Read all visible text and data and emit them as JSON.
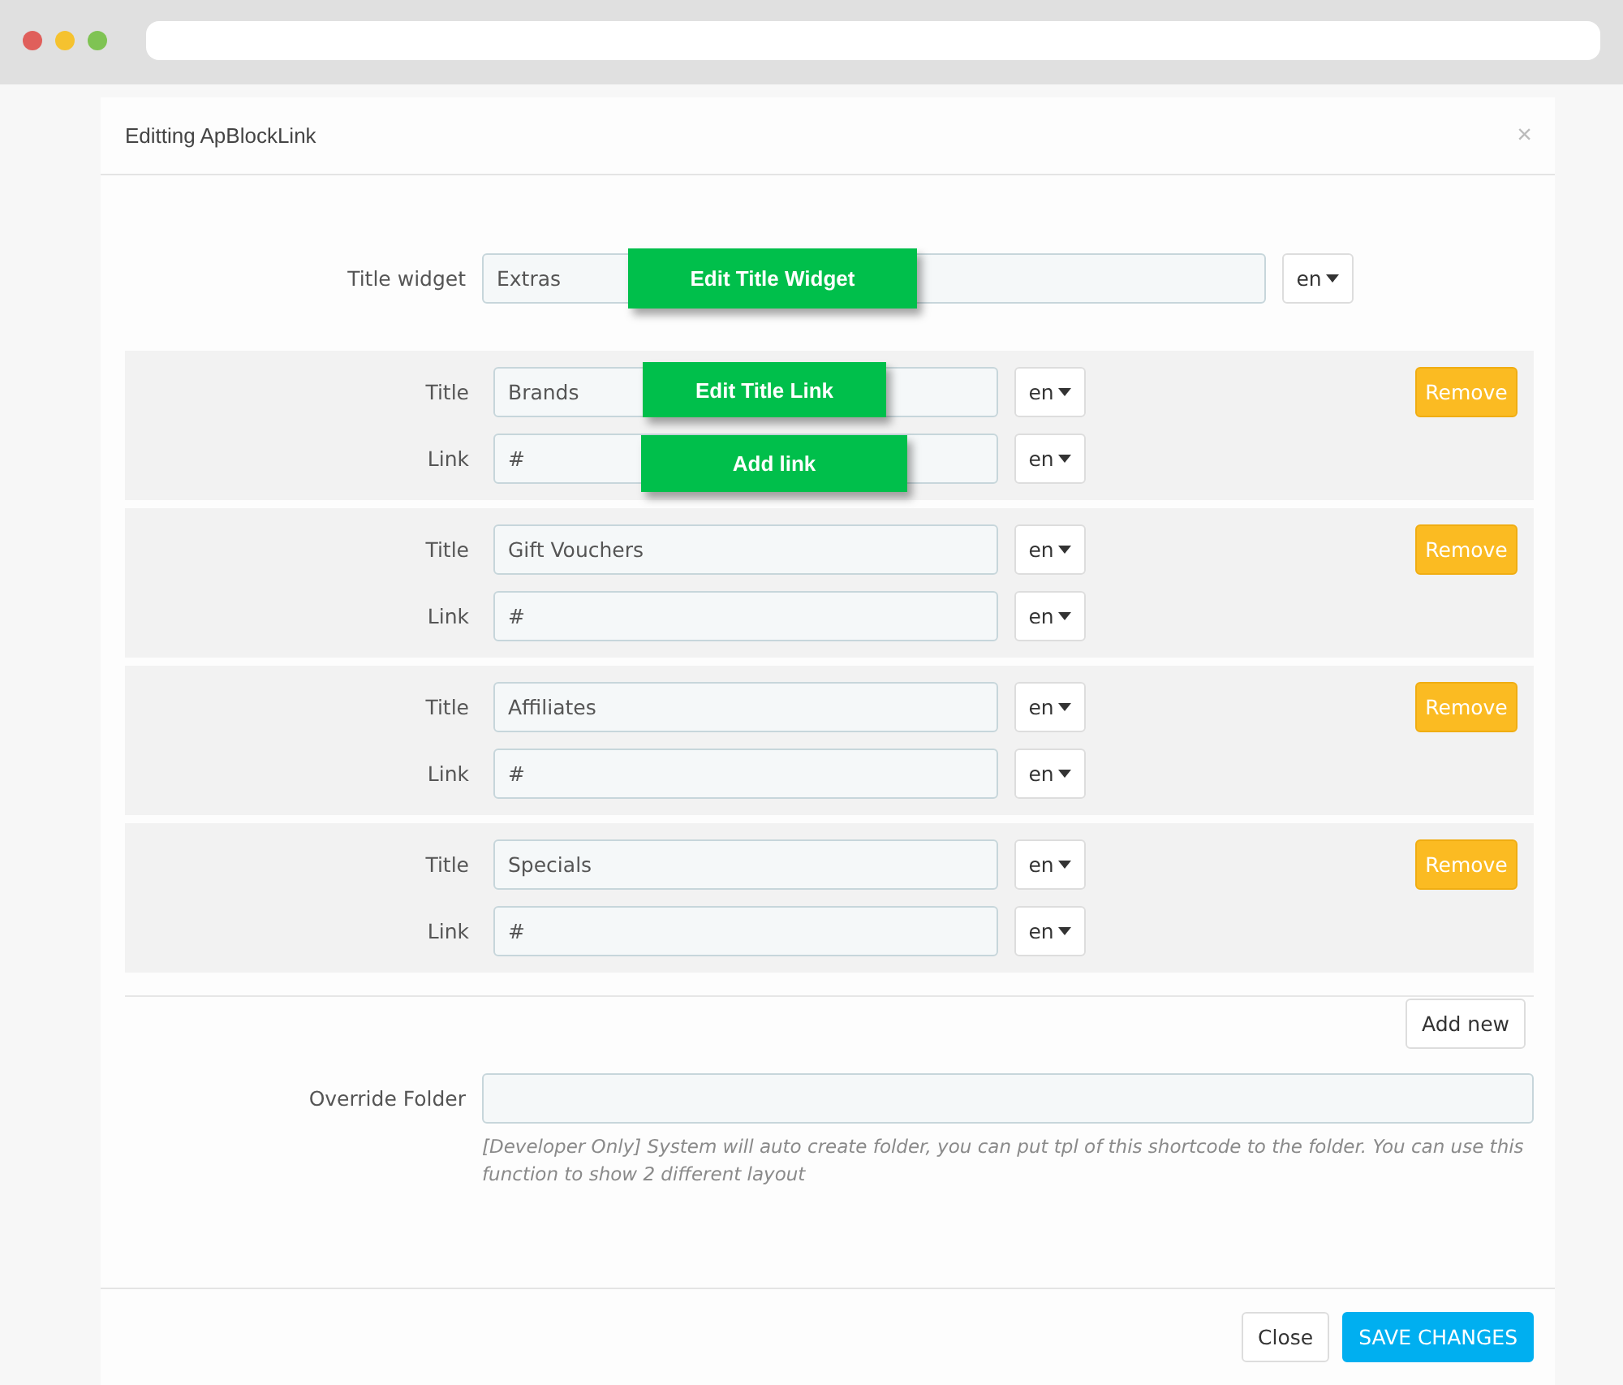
{
  "modal": {
    "title": "Editting ApBlockLink",
    "close": "×"
  },
  "title_widget": {
    "label": "Title widget",
    "value": "Extras",
    "lang": "en",
    "callout": "Edit Title Widget"
  },
  "links": [
    {
      "title_label": "Title",
      "title": "Brands",
      "title_lang": "en",
      "link_label": "Link",
      "link": "#",
      "link_lang": "en",
      "remove": "Remove",
      "title_callout": "Edit Title Link",
      "link_callout": "Add link"
    },
    {
      "title_label": "Title",
      "title": "Gift Vouchers",
      "title_lang": "en",
      "link_label": "Link",
      "link": "#",
      "link_lang": "en",
      "remove": "Remove"
    },
    {
      "title_label": "Title",
      "title": "Affiliates",
      "title_lang": "en",
      "link_label": "Link",
      "link": "#",
      "link_lang": "en",
      "remove": "Remove"
    },
    {
      "title_label": "Title",
      "title": "Specials",
      "title_lang": "en",
      "link_label": "Link",
      "link": "#",
      "link_lang": "en",
      "remove": "Remove"
    }
  ],
  "add_new": "Add new",
  "override_folder": {
    "label": "Override Folder",
    "help": "[Developer Only] System will auto create folder, you can put tpl of this shortcode to the folder. You can use this function to show 2 different layout"
  },
  "footer": {
    "close": "Close",
    "save": "SAVE CHANGES"
  }
}
